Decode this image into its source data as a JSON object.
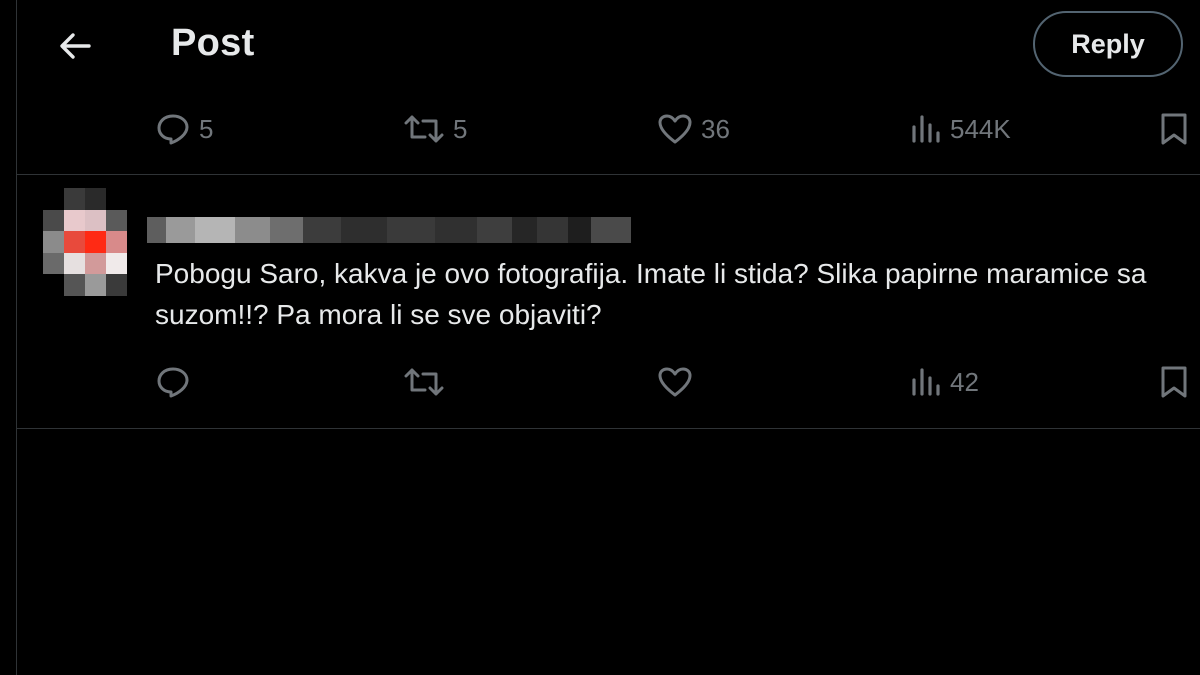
{
  "header": {
    "title": "Post",
    "reply_label": "Reply"
  },
  "main_post_actions": {
    "replies": "5",
    "reposts": "5",
    "likes": "36",
    "views": "544K"
  },
  "reply": {
    "text": "Pobogu Saro, kakva je ovo fotografija. Imate li stida? Slika papirne maramice sa suzom!!? Pa mora li se sve objaviti?",
    "actions": {
      "replies": "",
      "reposts": "",
      "likes": "",
      "views": "42"
    }
  },
  "colors": {
    "background": "#000000",
    "text": "#e7e9ea",
    "muted": "#71767b",
    "border": "#2f3336"
  },
  "icons": [
    "back-arrow-icon",
    "reply-icon",
    "repost-icon",
    "like-icon",
    "views-icon",
    "bookmark-icon"
  ]
}
